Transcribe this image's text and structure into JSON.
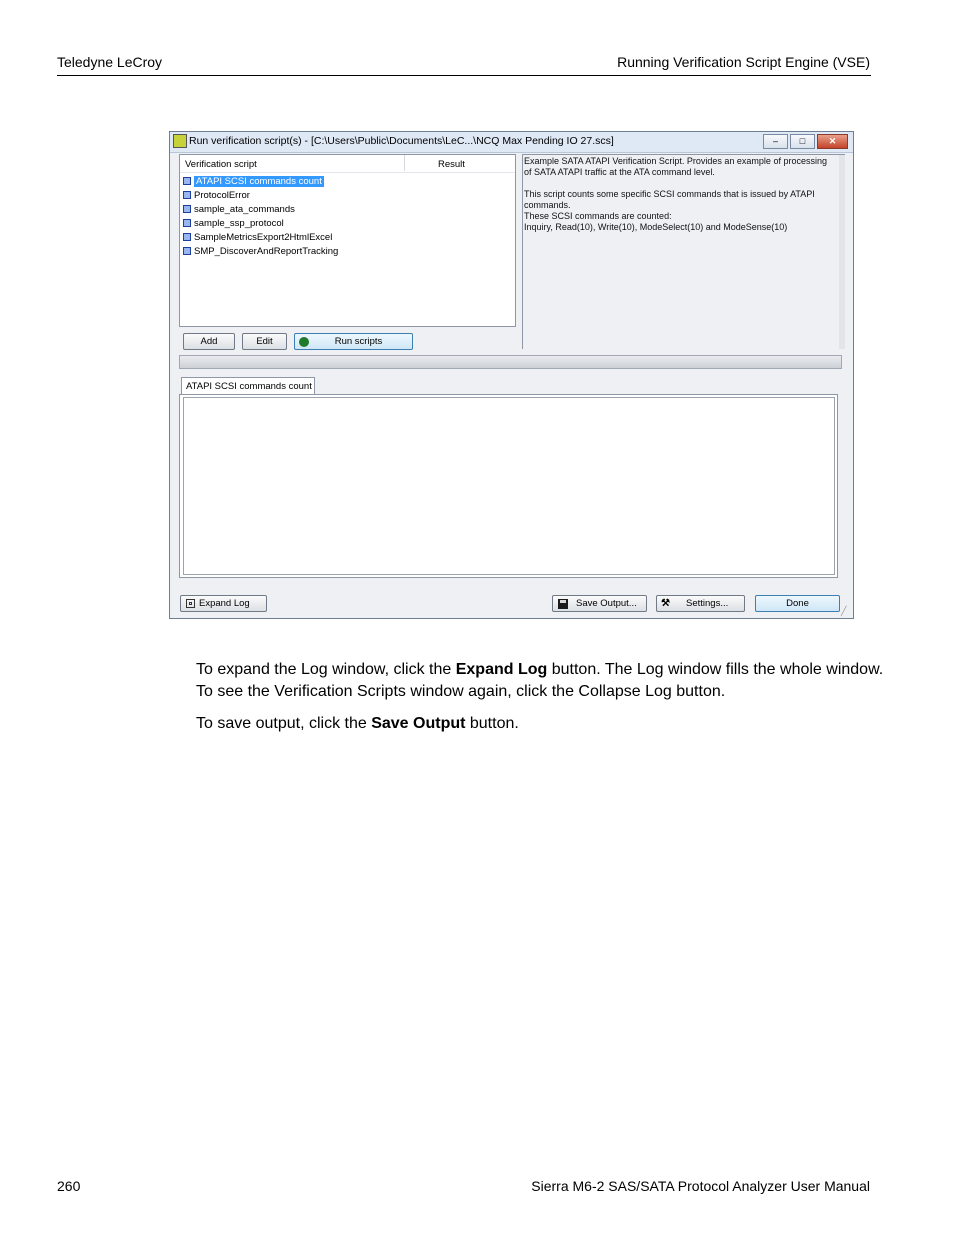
{
  "page": {
    "header_left": "Teledyne LeCroy",
    "header_right": "Running Verification Script Engine (VSE)",
    "footer_left": "260",
    "footer_right": "Sierra M6-2 SAS/SATA Protocol Analyzer User Manual"
  },
  "window": {
    "title": "Run verification script(s) - [C:\\Users\\Public\\Documents\\LeC...\\NCQ Max Pending IO 27.scs]",
    "min_glyph": "–",
    "max_glyph": "□",
    "close_glyph": "✕",
    "list": {
      "col_script": "Verification script",
      "col_result": "Result",
      "items": [
        "ATAPI SCSI commands count",
        "ProtocolError",
        "sample_ata_commands",
        "sample_ssp_protocol",
        "SampleMetricsExport2HtmlExcel",
        "SMP_DiscoverAndReportTracking"
      ],
      "selected_index": 0
    },
    "description": "Example SATA ATAPI Verification Script. Provides an example of processing\nof SATA ATAPI traffic at the ATA command level.\n\nThis script counts some specific SCSI commands that is issued by ATAPI commands.\nThese SCSI commands are counted:\nInquiry, Read(10), Write(10), ModeSelect(10) and ModeSense(10)",
    "buttons": {
      "add": "Add",
      "edit": "Edit",
      "run": "Run scripts",
      "expand_log": "Expand Log",
      "save_output": "Save Output...",
      "settings": "Settings...",
      "done": "Done"
    },
    "log_tab": "ATAPI SCSI commands count"
  },
  "body": {
    "p1_a": "To expand the Log window, click the ",
    "p1_b": "Expand Log",
    "p1_c": " button. The Log window fills the whole window. To see the Verification Scripts window again, click the Collapse Log button.",
    "p2_a": "To save output, click the ",
    "p2_b": "Save Output",
    "p2_c": " button."
  }
}
